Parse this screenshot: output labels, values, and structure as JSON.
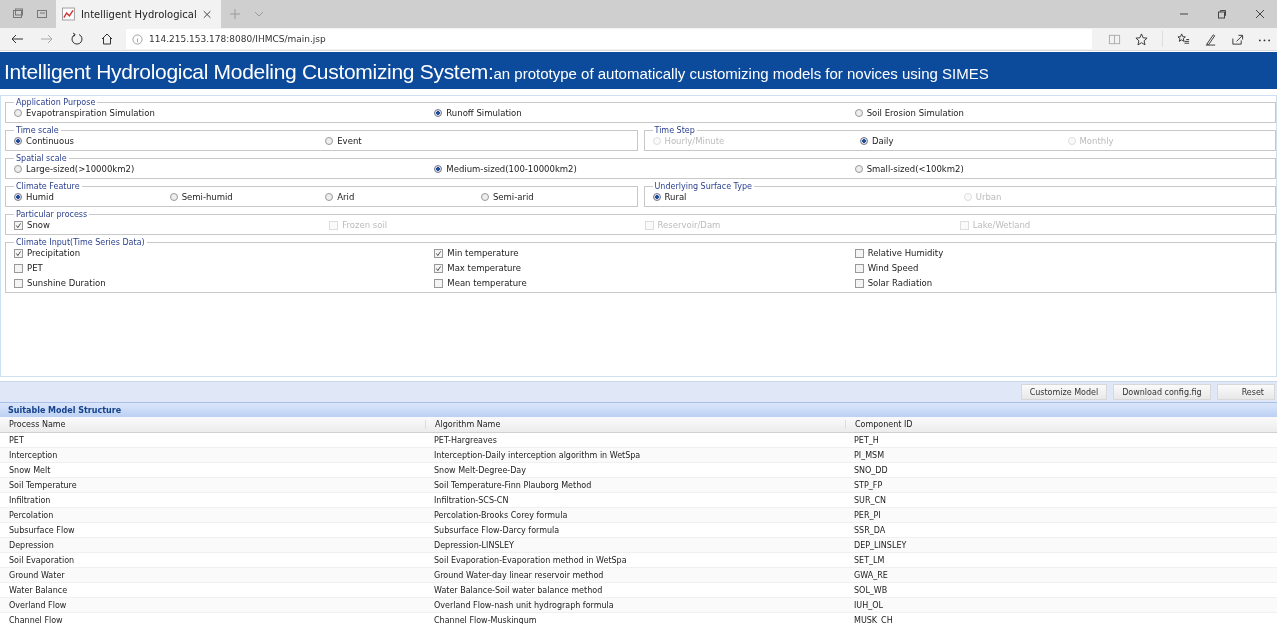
{
  "browser": {
    "tab_title": "Intelligent Hydrological",
    "address": "114.215.153.178:8080/IHMCS/main.jsp"
  },
  "banner": {
    "title": "Intelligent Hydrological Modeling Customizing System:",
    "subtitle": "an prototype of automatically customizing models for novices using SIMES"
  },
  "form_rows": [
    [
      {
        "legend": "Application Purpose",
        "kind": "radio",
        "columns": [
          [
            {
              "label": "Evapotranspiration Simulation",
              "selected": false,
              "disabled": false
            }
          ],
          [
            {
              "label": "Runoff Simulation",
              "selected": true,
              "disabled": false
            }
          ],
          [
            {
              "label": "Soil Erosion Simulation",
              "selected": false,
              "disabled": false
            }
          ]
        ]
      }
    ],
    [
      {
        "legend": "Time scale",
        "kind": "radio",
        "columns": [
          [
            {
              "label": "Continuous",
              "selected": true,
              "disabled": false
            }
          ],
          [
            {
              "label": "Event",
              "selected": false,
              "disabled": false
            }
          ]
        ]
      },
      {
        "legend": "Time Step",
        "kind": "radio",
        "columns": [
          [
            {
              "label": "Hourly/Minute",
              "selected": false,
              "disabled": true
            }
          ],
          [
            {
              "label": "Daily",
              "selected": true,
              "disabled": false
            }
          ],
          [
            {
              "label": "Monthly",
              "selected": false,
              "disabled": true
            }
          ]
        ]
      }
    ],
    [
      {
        "legend": "Spatial scale",
        "kind": "radio",
        "columns": [
          [
            {
              "label": "Large-sized(>10000km2)",
              "selected": false,
              "disabled": false
            }
          ],
          [
            {
              "label": "Medium-sized(100-10000km2)",
              "selected": true,
              "disabled": false
            }
          ],
          [
            {
              "label": "Small-sized(<100km2)",
              "selected": false,
              "disabled": false
            }
          ]
        ]
      }
    ],
    [
      {
        "legend": "Climate Feature",
        "kind": "radio",
        "columns": [
          [
            {
              "label": "Humid",
              "selected": true,
              "disabled": false
            }
          ],
          [
            {
              "label": "Semi-humid",
              "selected": false,
              "disabled": false
            }
          ],
          [
            {
              "label": "Arid",
              "selected": false,
              "disabled": false
            }
          ],
          [
            {
              "label": "Semi-arid",
              "selected": false,
              "disabled": false
            }
          ]
        ]
      },
      {
        "legend": "Underlying Surface Type",
        "kind": "radio",
        "columns": [
          [
            {
              "label": "Rural",
              "selected": true,
              "disabled": false
            }
          ],
          [
            {
              "label": "Urban",
              "selected": false,
              "disabled": true
            }
          ]
        ]
      }
    ],
    [
      {
        "legend": "Particular process",
        "kind": "checkbox",
        "columns": [
          [
            {
              "label": "Snow",
              "checked": true,
              "disabled": false
            }
          ],
          [
            {
              "label": "Frozen soil",
              "checked": false,
              "disabled": true
            }
          ],
          [
            {
              "label": "Reservoir/Dam",
              "checked": false,
              "disabled": true
            }
          ],
          [
            {
              "label": "Lake/Wetland",
              "checked": false,
              "disabled": true
            }
          ]
        ]
      }
    ],
    [
      {
        "legend": "Climate Input(Time Series Data)",
        "kind": "checkbox",
        "columns": [
          [
            {
              "label": "Precipitation",
              "checked": true,
              "disabled": false
            },
            {
              "label": "PET",
              "checked": false,
              "disabled": false
            },
            {
              "label": "Sunshine Duration",
              "checked": false,
              "disabled": false
            }
          ],
          [
            {
              "label": "Min temperature",
              "checked": true,
              "disabled": false
            },
            {
              "label": "Max temperature",
              "checked": true,
              "disabled": false
            },
            {
              "label": "Mean temperature",
              "checked": false,
              "disabled": false
            }
          ],
          [
            {
              "label": "Relative Humidity",
              "checked": false,
              "disabled": false
            },
            {
              "label": "Wind Speed",
              "checked": false,
              "disabled": false
            },
            {
              "label": "Solar Radiation",
              "checked": false,
              "disabled": false
            }
          ]
        ]
      }
    ]
  ],
  "buttons": [
    "Customize Model",
    "Download config.fig",
    "Reset"
  ],
  "table": {
    "title": "Suitable Model Structure",
    "columns": [
      "Process Name",
      "Algorithm Name",
      "Component ID"
    ],
    "rows": [
      [
        "PET",
        "PET-Hargreaves",
        "PET_H"
      ],
      [
        "Interception",
        "Interception-Daily interception algorithm in WetSpa",
        "PI_MSM"
      ],
      [
        "Snow Melt",
        "Snow Melt-Degree-Day",
        "SNO_DD"
      ],
      [
        "Soil Temperature",
        "Soil Temperature-Finn Plauborg Method",
        "STP_FP"
      ],
      [
        "Infiltration",
        "Infiltration-SCS-CN",
        "SUR_CN"
      ],
      [
        "Percolation",
        "Percolation-Brooks Corey formula",
        "PER_PI"
      ],
      [
        "Subsurface Flow",
        "Subsurface Flow-Darcy formula",
        "SSR_DA"
      ],
      [
        "Depression",
        "Depression-LINSLEY",
        "DEP_LINSLEY"
      ],
      [
        "Soil Evaporation",
        "Soil Evaporation-Evaporation method in WetSpa",
        "SET_LM"
      ],
      [
        "Ground Water",
        "Ground Water-day linear reservoir method",
        "GWA_RE"
      ],
      [
        "Water Balance",
        "Water Balance-Soil water balance method",
        "SOL_WB"
      ],
      [
        "Overland Flow",
        "Overland Flow-nash unit hydrograph formula",
        "IUH_OL"
      ],
      [
        "Channel Flow",
        "Channel Flow-Muskingum",
        "MUSK_CH"
      ]
    ]
  }
}
